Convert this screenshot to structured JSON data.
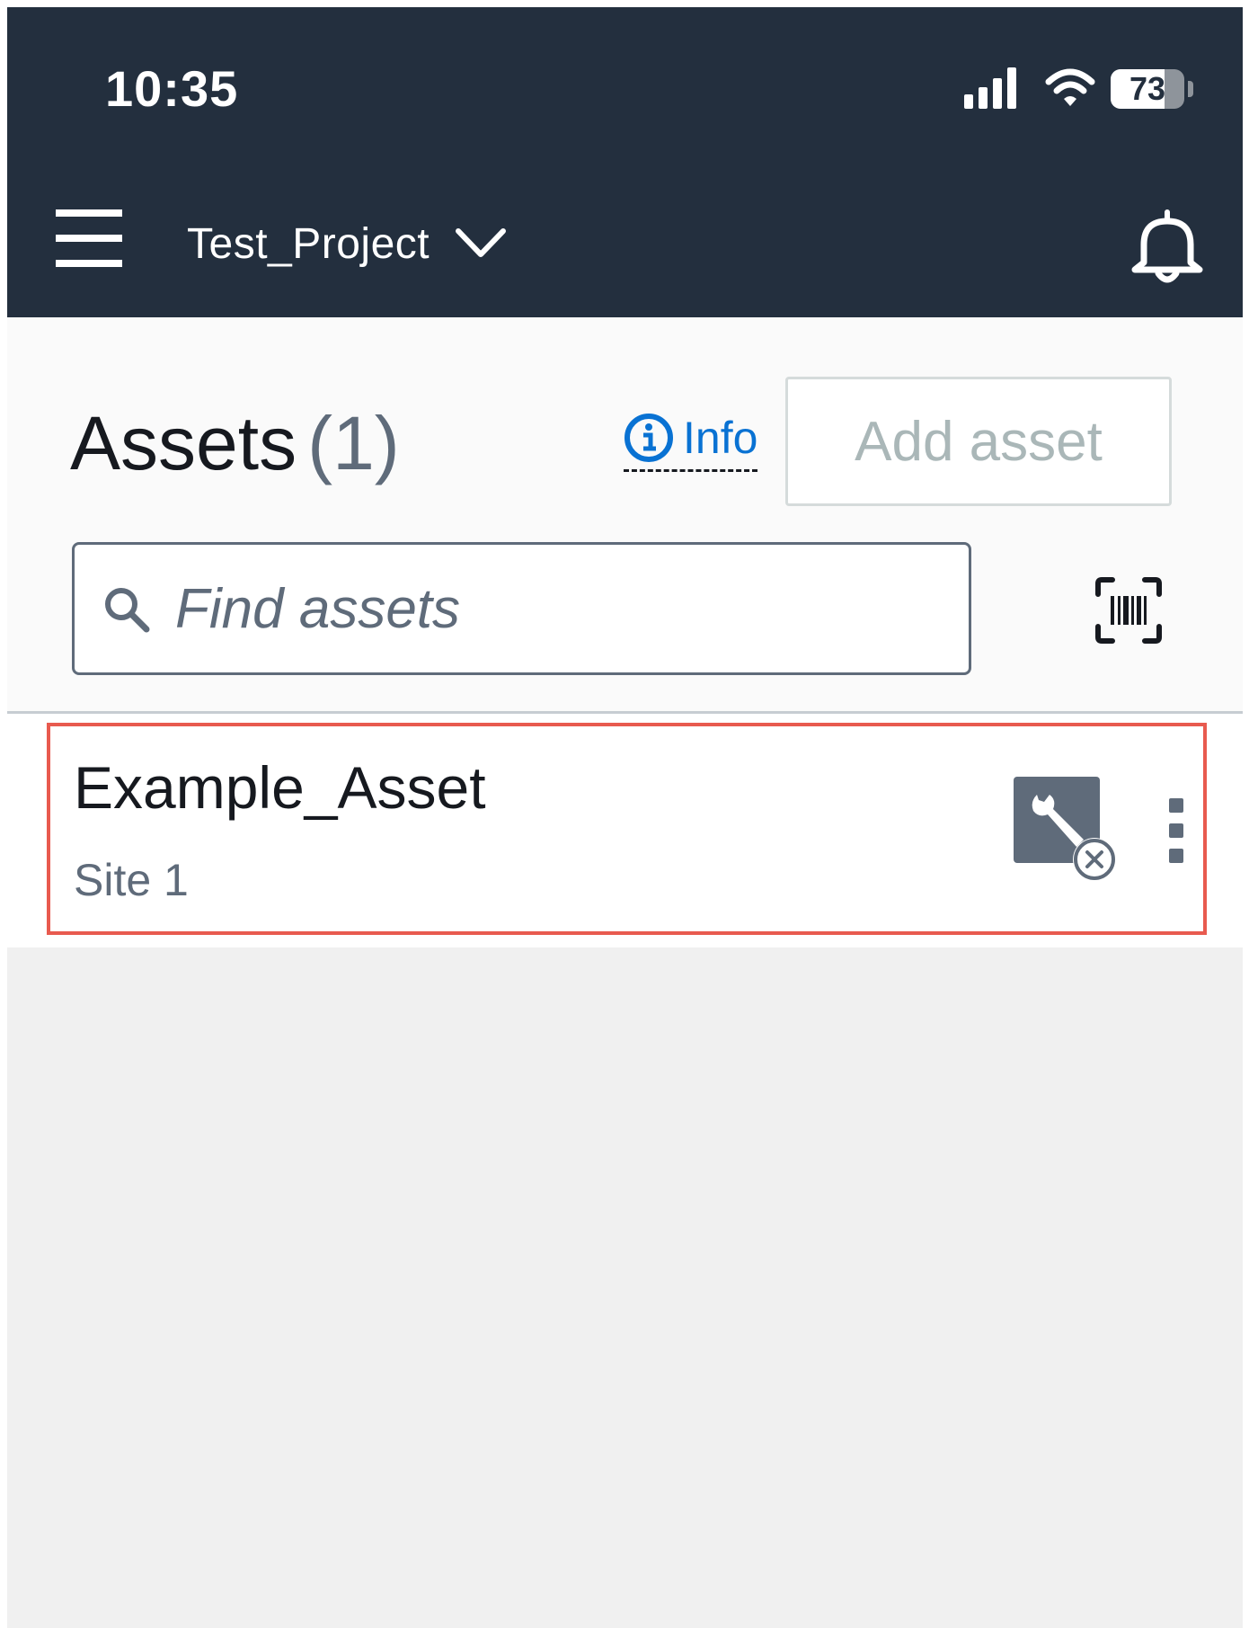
{
  "status_bar": {
    "time": "10:35",
    "battery_percent": 73,
    "battery_label": "73"
  },
  "header": {
    "project_name": "Test_Project",
    "icons": [
      "menu-icon",
      "chevron-down-icon",
      "bell-icon"
    ],
    "background_color": "#232f3e"
  },
  "assets_page": {
    "title": "Assets",
    "count_label": "(1)",
    "info_label": "Info",
    "add_button_label": "Add asset",
    "search": {
      "placeholder": "Find assets",
      "value": ""
    },
    "scan_icon": "barcode-scan-icon"
  },
  "asset_list": [
    {
      "name": "Example_Asset",
      "site": "Site 1",
      "status_icon": "wrench-disconnected-icon"
    }
  ],
  "colors": {
    "link": "#0972d3",
    "highlight_border": "#e85a4f",
    "muted_text": "#5f6b7a"
  }
}
